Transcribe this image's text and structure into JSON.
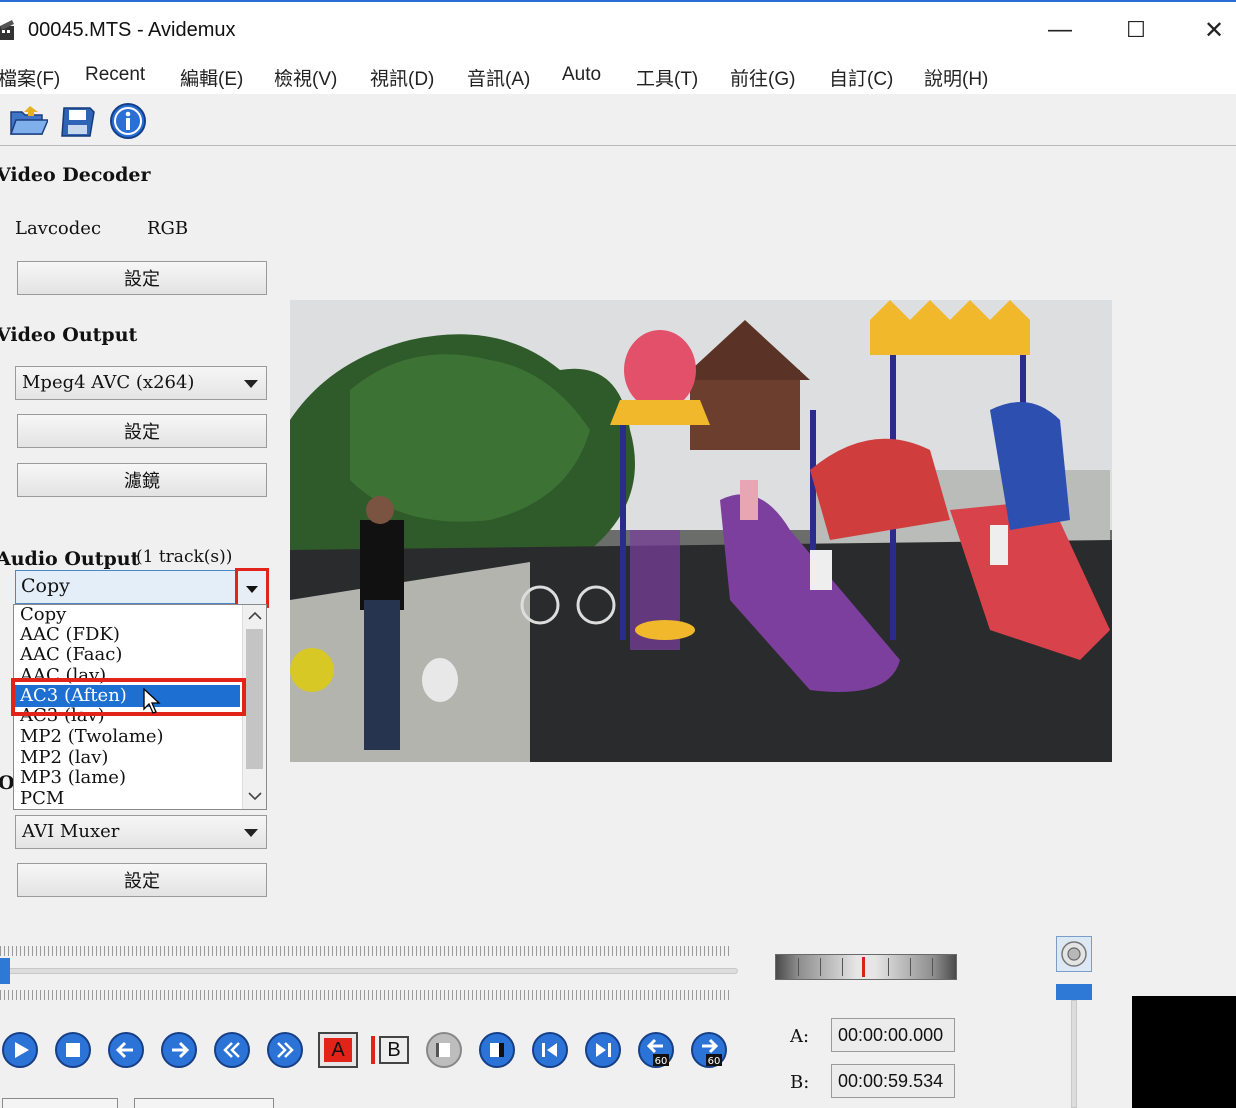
{
  "window": {
    "title": "00045.MTS - Avidemux",
    "controls": {
      "minimize": "—",
      "maximize": "☐",
      "close": "✕"
    }
  },
  "menu": {
    "items": [
      "檔案(F)",
      "Recent",
      "編輯(E)",
      "檢視(V)",
      "視訊(D)",
      "音訊(A)",
      "Auto",
      "工具(T)",
      "前往(G)",
      "自訂(C)",
      "說明(H)"
    ]
  },
  "toolbar": {
    "icons": [
      "open-folder-icon",
      "save-disk-icon",
      "info-icon"
    ]
  },
  "video_decoder": {
    "title": "Video Decoder",
    "codec": "Lavcodec",
    "colorspace": "RGB",
    "settings_label": "設定"
  },
  "video_output": {
    "title": "Video Output",
    "selected": "Mpeg4 AVC (x264)",
    "settings_label": "設定",
    "filters_label": "濾鏡"
  },
  "audio_output": {
    "title": "Audio Output",
    "tracks": "(1 track(s))",
    "selected": "Copy",
    "options": [
      "Copy",
      "AAC (FDK)",
      "AAC (Faac)",
      "AAC (lav)",
      "AC3 (Aften)",
      "AC3 (lav)",
      "MP2 (Twolame)",
      "MP2 (lav)",
      "MP3 (lame)",
      "PCM"
    ],
    "highlighted": "AC3 (Aften)"
  },
  "output_format": {
    "title_fragment": "O",
    "selected": "AVI Muxer",
    "settings_label": "設定"
  },
  "markers": {
    "a_label": "A:",
    "a_time": "00:00:00.000",
    "b_label": "B:",
    "b_time": "00:00:59.534"
  },
  "playback_controls": {
    "icons": [
      "play-icon",
      "stop-icon",
      "previous-frame-icon",
      "next-frame-icon",
      "rewind-icon",
      "fast-forward-icon",
      "set-marker-a-icon",
      "set-marker-b-icon",
      "previous-black-frame-icon",
      "next-black-frame-icon",
      "go-to-first-frame-icon",
      "go-to-last-frame-icon",
      "back-60s-icon",
      "forward-60s-icon"
    ],
    "marker_a_text": "A",
    "marker_b_text": "B",
    "jump_label": "60"
  },
  "colors": {
    "accent": "#2e78d6",
    "selection": "#1e6fd2",
    "annotation_red": "#e2231a"
  }
}
